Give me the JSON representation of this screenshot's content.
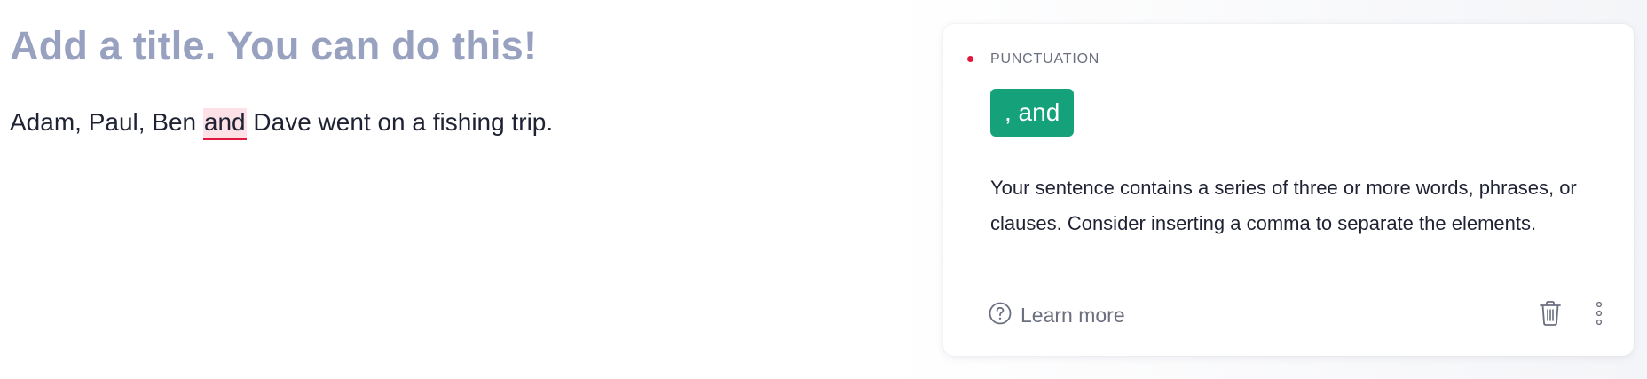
{
  "editor": {
    "title": "Add a title. You can do this!",
    "sentence_before": "Adam, Paul, Ben ",
    "flagged_word": "and",
    "sentence_after": " Dave went on a fishing trip."
  },
  "card": {
    "category": "PUNCTUATION",
    "category_color": "#e2173f",
    "suggestion": ", and",
    "suggestion_color": "#15a27b",
    "explanation": "Your sentence contains a series of three or more words, phrases, or clauses. Consider inserting a comma to separate the elements.",
    "learn_more": "Learn more",
    "icons": {
      "learn_more": "question-circle-icon",
      "delete": "trash-icon",
      "more": "more-vertical-icon"
    }
  }
}
